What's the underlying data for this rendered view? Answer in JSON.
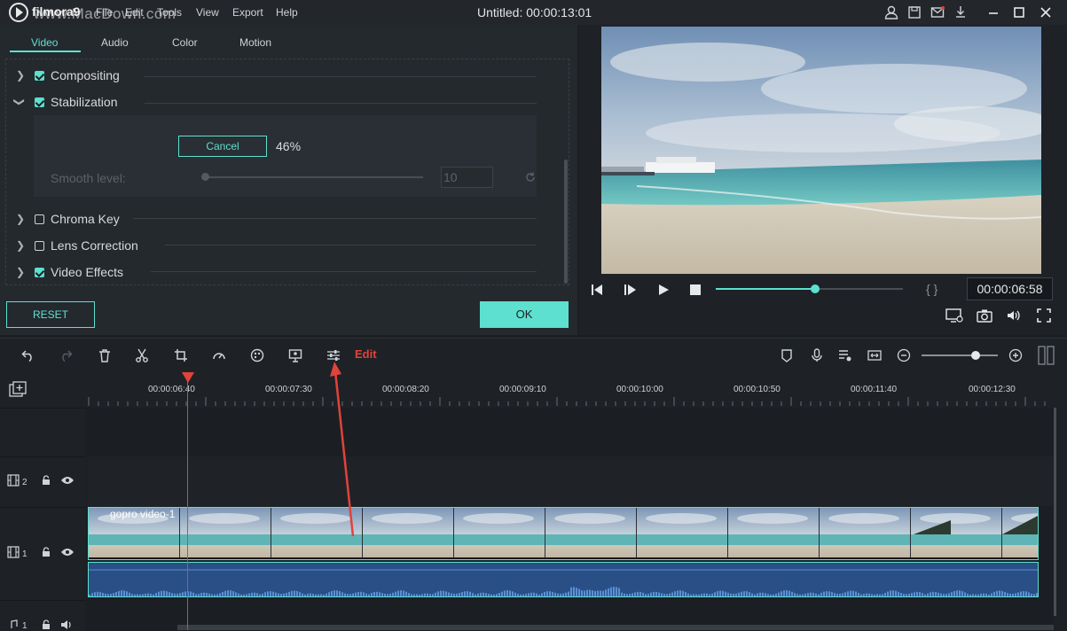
{
  "app": {
    "brand": "filmora9",
    "watermark": "www.MacDown.com",
    "window_title": "Untitled:  00:00:13:01",
    "menu": [
      "File",
      "Edit",
      "Tools",
      "View",
      "Export",
      "Help"
    ]
  },
  "tabs": [
    "Video",
    "Audio",
    "Color",
    "Motion"
  ],
  "properties": {
    "compositing": {
      "label": "Compositing",
      "checked": true
    },
    "stabilization": {
      "label": "Stabilization",
      "checked": true
    },
    "cancel_label": "Cancel",
    "progress": "46%",
    "smooth_label": "Smooth level:",
    "smooth_value": "10",
    "chroma_key": {
      "label": "Chroma Key",
      "checked": false
    },
    "lens_correction": {
      "label": "Lens Correction",
      "checked": false
    },
    "video_effects": {
      "label": "Video Effects",
      "checked": true
    }
  },
  "buttons": {
    "reset": "RESET",
    "ok": "OK"
  },
  "player": {
    "timecode": "00:00:06:58",
    "braces": "{ }",
    "progress_fraction": 0.53
  },
  "toolbar": {
    "edit_label": "Edit"
  },
  "timeline": {
    "ticks": [
      "00:00:06:40",
      "00:00:07:30",
      "00:00:08:20",
      "00:00:09:10",
      "00:00:10:00",
      "00:00:10:50",
      "00:00:11:40",
      "00:00:12:30"
    ],
    "tracks": [
      {
        "number": "2"
      },
      {
        "number": "1"
      },
      {
        "number": "1"
      }
    ],
    "clip_name": "gopro video-1"
  },
  "colors": {
    "accent": "#5de0cf",
    "playhead": "#e0433b",
    "edit_label": "#e0433b"
  }
}
